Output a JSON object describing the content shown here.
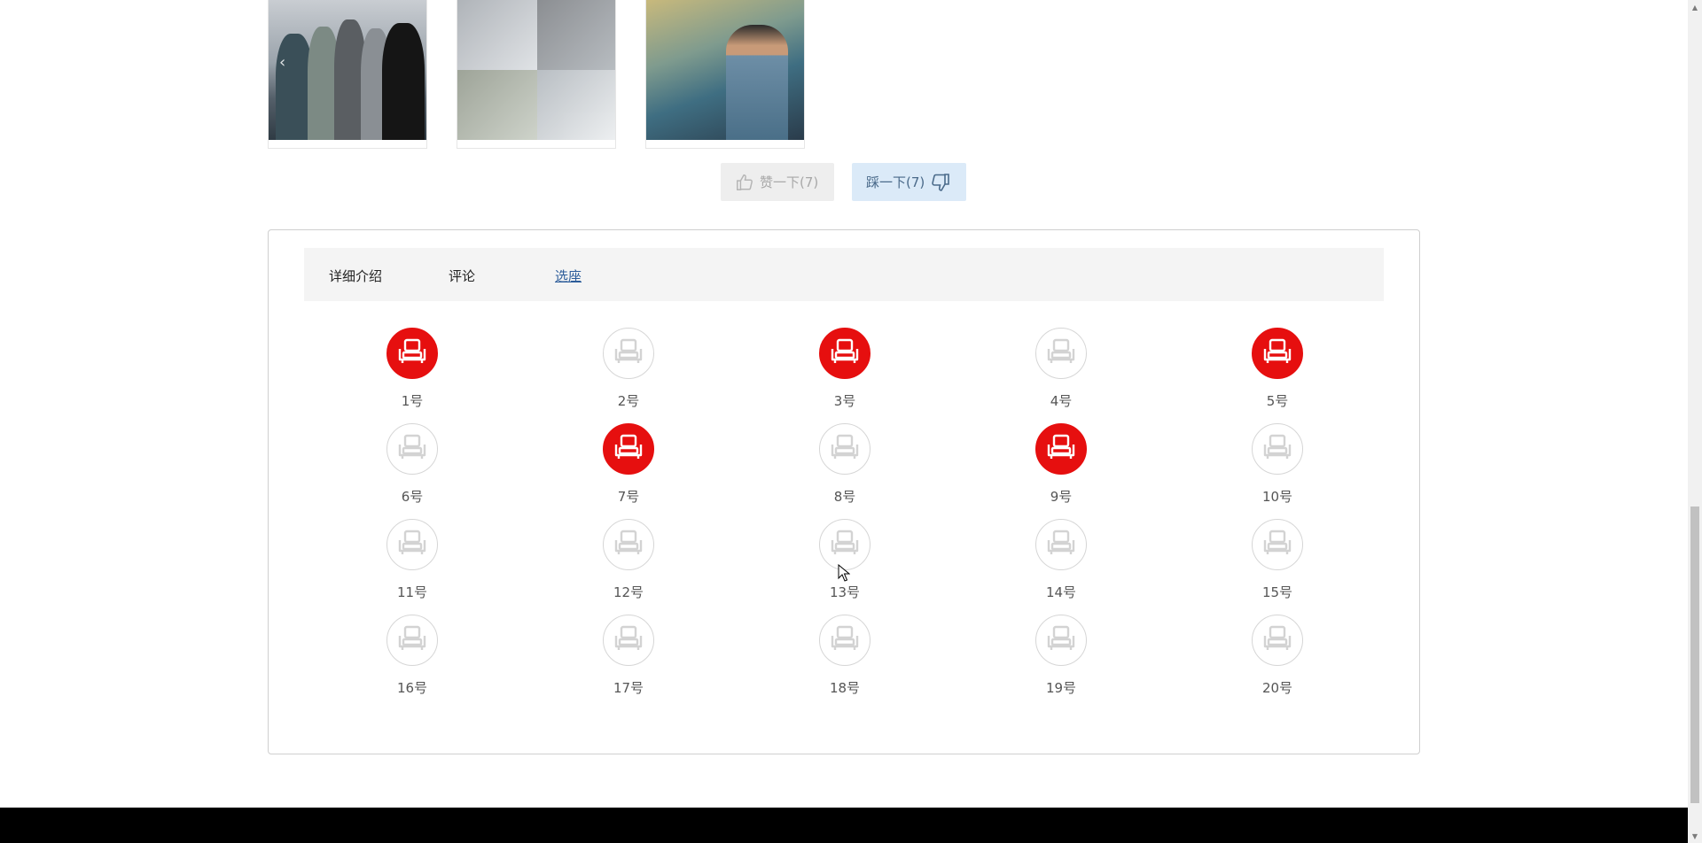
{
  "gallery": [
    {
      "kind": "band-photo"
    },
    {
      "kind": "concert-collage"
    },
    {
      "kind": "album-poster"
    }
  ],
  "votes": {
    "like_label": "赞一下(7)",
    "dislike_label": "踩一下(7)",
    "like_icon": "thumbs-up-icon",
    "dislike_icon": "thumbs-down-icon"
  },
  "tabs": [
    {
      "label": "详细介绍",
      "active": false
    },
    {
      "label": "评论",
      "active": false
    },
    {
      "label": "选座",
      "active": true
    }
  ],
  "seats": [
    {
      "label": "1号",
      "taken": true
    },
    {
      "label": "2号",
      "taken": false
    },
    {
      "label": "3号",
      "taken": true
    },
    {
      "label": "4号",
      "taken": false
    },
    {
      "label": "5号",
      "taken": true
    },
    {
      "label": "6号",
      "taken": false
    },
    {
      "label": "7号",
      "taken": true
    },
    {
      "label": "8号",
      "taken": false
    },
    {
      "label": "9号",
      "taken": true
    },
    {
      "label": "10号",
      "taken": false
    },
    {
      "label": "11号",
      "taken": false
    },
    {
      "label": "12号",
      "taken": false
    },
    {
      "label": "13号",
      "taken": false
    },
    {
      "label": "14号",
      "taken": false
    },
    {
      "label": "15号",
      "taken": false
    },
    {
      "label": "16号",
      "taken": false
    },
    {
      "label": "17号",
      "taken": false
    },
    {
      "label": "18号",
      "taken": false
    },
    {
      "label": "19号",
      "taken": false
    },
    {
      "label": "20号",
      "taken": false
    }
  ],
  "colors": {
    "seat_taken": "#e60f0f",
    "seat_free_border": "#d6d6d6",
    "active_tab": "#2d5d9a"
  }
}
